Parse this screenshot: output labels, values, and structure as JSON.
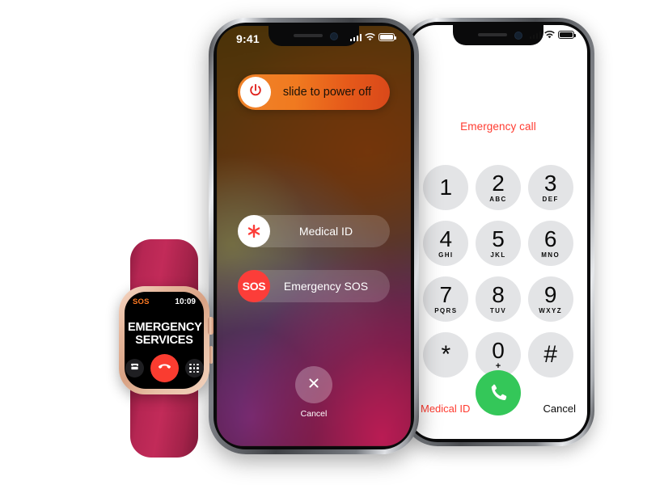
{
  "scene": {
    "title": "Apple Emergency SOS devices",
    "background_color": "#ffffff"
  },
  "phone_left": {
    "status_bar": {
      "time": "9:41",
      "signal_icon": "cellular-bars-icon",
      "wifi_icon": "wifi-icon",
      "battery_icon": "battery-icon"
    },
    "power_slider": {
      "label": "slide to power off",
      "knob_icon": "power-icon",
      "track_color": "#f07a20"
    },
    "medical_id": {
      "label": "Medical ID",
      "icon": "medical-asterisk-icon",
      "icon_color": "#fc3d39"
    },
    "emergency_sos": {
      "label": "Emergency SOS",
      "icon_text": "SOS",
      "icon_color": "#fc3d39"
    },
    "cancel": {
      "label": "Cancel",
      "icon": "close-x-icon"
    }
  },
  "phone_right": {
    "status_bar": {
      "signal_icon": "cellular-bars-icon",
      "wifi_icon": "wifi-icon",
      "battery_icon": "battery-icon"
    },
    "header": "Emergency call",
    "header_color": "#ff3b30",
    "keypad": [
      {
        "digit": "1",
        "letters": ""
      },
      {
        "digit": "2",
        "letters": "ABC"
      },
      {
        "digit": "3",
        "letters": "DEF"
      },
      {
        "digit": "4",
        "letters": "GHI"
      },
      {
        "digit": "5",
        "letters": "JKL"
      },
      {
        "digit": "6",
        "letters": "MNO"
      },
      {
        "digit": "7",
        "letters": "PQRS"
      },
      {
        "digit": "8",
        "letters": "TUV"
      },
      {
        "digit": "9",
        "letters": "WXYZ"
      },
      {
        "digit": "*",
        "letters": ""
      },
      {
        "digit": "0",
        "letters": "+"
      },
      {
        "digit": "#",
        "letters": ""
      }
    ],
    "call_button": {
      "icon": "phone-handset-icon",
      "color": "#34c759"
    },
    "footer": {
      "medical_id": "Medical ID",
      "cancel": "Cancel"
    }
  },
  "watch": {
    "status": {
      "sos_label": "SOS",
      "sos_color": "#ff7a23",
      "time": "10:09"
    },
    "title_line1": "EMERGENCY",
    "title_line2": "SERVICES",
    "buttons": {
      "speaker_icon": "telephone-handset-icon",
      "end_call_icon": "end-call-icon",
      "end_call_color": "#fa3c30",
      "keypad_icon": "keypad-grid-icon"
    },
    "band_color": "#b62653",
    "case_color": "#e6b79c"
  }
}
